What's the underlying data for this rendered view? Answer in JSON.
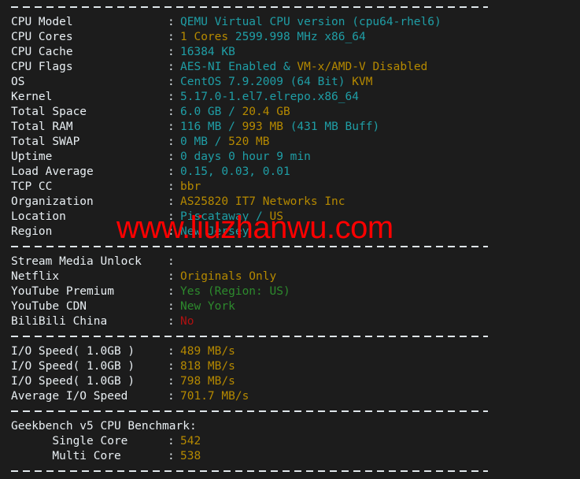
{
  "theme": {
    "background": "#1c1c1c",
    "label_color": "#e9eff3",
    "cyan": "#1f9ea6",
    "gold": "#b58900",
    "green": "#2d8a2d",
    "red": "#b01111",
    "watermark_color": "#ff0000"
  },
  "watermark": {
    "text": "www.liuzhanwu.com"
  },
  "sections": {
    "system": {
      "rows": [
        {
          "label": "CPU Model",
          "colon": ":",
          "parts": [
            {
              "text": "QEMU Virtual CPU version (cpu64-rhel6)",
              "color": "cyan"
            }
          ]
        },
        {
          "label": "CPU Cores",
          "colon": ":",
          "parts": [
            {
              "text": "1 Cores",
              "color": "gold"
            },
            {
              "text": " 2599.998 MHz x86_64",
              "color": "cyan"
            }
          ]
        },
        {
          "label": "CPU Cache",
          "colon": ":",
          "parts": [
            {
              "text": "16384 KB",
              "color": "cyan"
            }
          ]
        },
        {
          "label": "CPU Flags",
          "colon": ":",
          "parts": [
            {
              "text": "AES-NI Enabled",
              "color": "cyan"
            },
            {
              "text": " & ",
              "color": "cyan"
            },
            {
              "text": "VM-x/AMD-V Disabled",
              "color": "gold"
            }
          ]
        },
        {
          "label": "OS",
          "colon": ":",
          "parts": [
            {
              "text": "CentOS 7.9.2009 (64 Bit) ",
              "color": "cyan"
            },
            {
              "text": "KVM",
              "color": "gold"
            }
          ]
        },
        {
          "label": "Kernel",
          "colon": ":",
          "parts": [
            {
              "text": "5.17.0-1.el7.elrepo.x86_64",
              "color": "cyan"
            }
          ]
        },
        {
          "label": "Total Space",
          "colon": ":",
          "parts": [
            {
              "text": "6.0 GB / ",
              "color": "cyan"
            },
            {
              "text": "20.4 GB",
              "color": "gold"
            }
          ]
        },
        {
          "label": "Total RAM",
          "colon": ":",
          "parts": [
            {
              "text": "116 MB / ",
              "color": "cyan"
            },
            {
              "text": "993 MB",
              "color": "gold"
            },
            {
              "text": " (431 MB Buff)",
              "color": "cyan"
            }
          ]
        },
        {
          "label": "Total SWAP",
          "colon": ":",
          "parts": [
            {
              "text": "0 MB / ",
              "color": "cyan"
            },
            {
              "text": "520 MB",
              "color": "gold"
            }
          ]
        },
        {
          "label": "Uptime",
          "colon": ":",
          "parts": [
            {
              "text": "0 days 0 hour 9 min",
              "color": "cyan"
            }
          ]
        },
        {
          "label": "Load Average",
          "colon": ":",
          "parts": [
            {
              "text": "0.15, 0.03, 0.01",
              "color": "cyan"
            }
          ]
        },
        {
          "label": "TCP CC",
          "colon": ":",
          "parts": [
            {
              "text": "bbr",
              "color": "gold"
            }
          ]
        },
        {
          "label": "Organization",
          "colon": ":",
          "parts": [
            {
              "text": "AS25820 IT7 Networks Inc",
              "color": "gold"
            }
          ]
        },
        {
          "label": "Location",
          "colon": ":",
          "parts": [
            {
              "text": "Piscataway / ",
              "color": "cyan"
            },
            {
              "text": "US",
              "color": "gold"
            }
          ]
        },
        {
          "label": "Region",
          "colon": ":",
          "parts": [
            {
              "text": "New Jersey",
              "color": "cyan"
            }
          ]
        }
      ]
    },
    "stream_media": {
      "rows": [
        {
          "label": "Stream Media Unlock",
          "colon": ":",
          "parts": []
        },
        {
          "label": "Netflix",
          "colon": ":",
          "parts": [
            {
              "text": "Originals Only",
              "color": "gold"
            }
          ]
        },
        {
          "label": "YouTube Premium",
          "colon": ":",
          "parts": [
            {
              "text": "Yes (Region: US)",
              "color": "green"
            }
          ]
        },
        {
          "label": "YouTube CDN",
          "colon": ":",
          "parts": [
            {
              "text": "New York",
              "color": "green"
            }
          ]
        },
        {
          "label": "BiliBili China",
          "colon": ":",
          "parts": [
            {
              "text": "No",
              "color": "red"
            }
          ]
        }
      ]
    },
    "io": {
      "rows": [
        {
          "label": "I/O Speed( 1.0GB )",
          "colon": ":",
          "parts": [
            {
              "text": "489 MB/s",
              "color": "gold"
            }
          ]
        },
        {
          "label": "I/O Speed( 1.0GB )",
          "colon": ":",
          "parts": [
            {
              "text": "818 MB/s",
              "color": "gold"
            }
          ]
        },
        {
          "label": "I/O Speed( 1.0GB )",
          "colon": ":",
          "parts": [
            {
              "text": "798 MB/s",
              "color": "gold"
            }
          ]
        },
        {
          "label": "Average I/O Speed",
          "colon": ":",
          "parts": [
            {
              "text": "701.7 MB/s",
              "color": "gold"
            }
          ]
        }
      ]
    },
    "geekbench": {
      "heading": "Geekbench v5 CPU Benchmark:",
      "rows": [
        {
          "label": "      Single Core",
          "colon": ":",
          "parts": [
            {
              "text": "542",
              "color": "gold"
            }
          ]
        },
        {
          "label": "      Multi Core",
          "colon": ":",
          "parts": [
            {
              "text": "538",
              "color": "gold"
            }
          ]
        }
      ]
    }
  }
}
